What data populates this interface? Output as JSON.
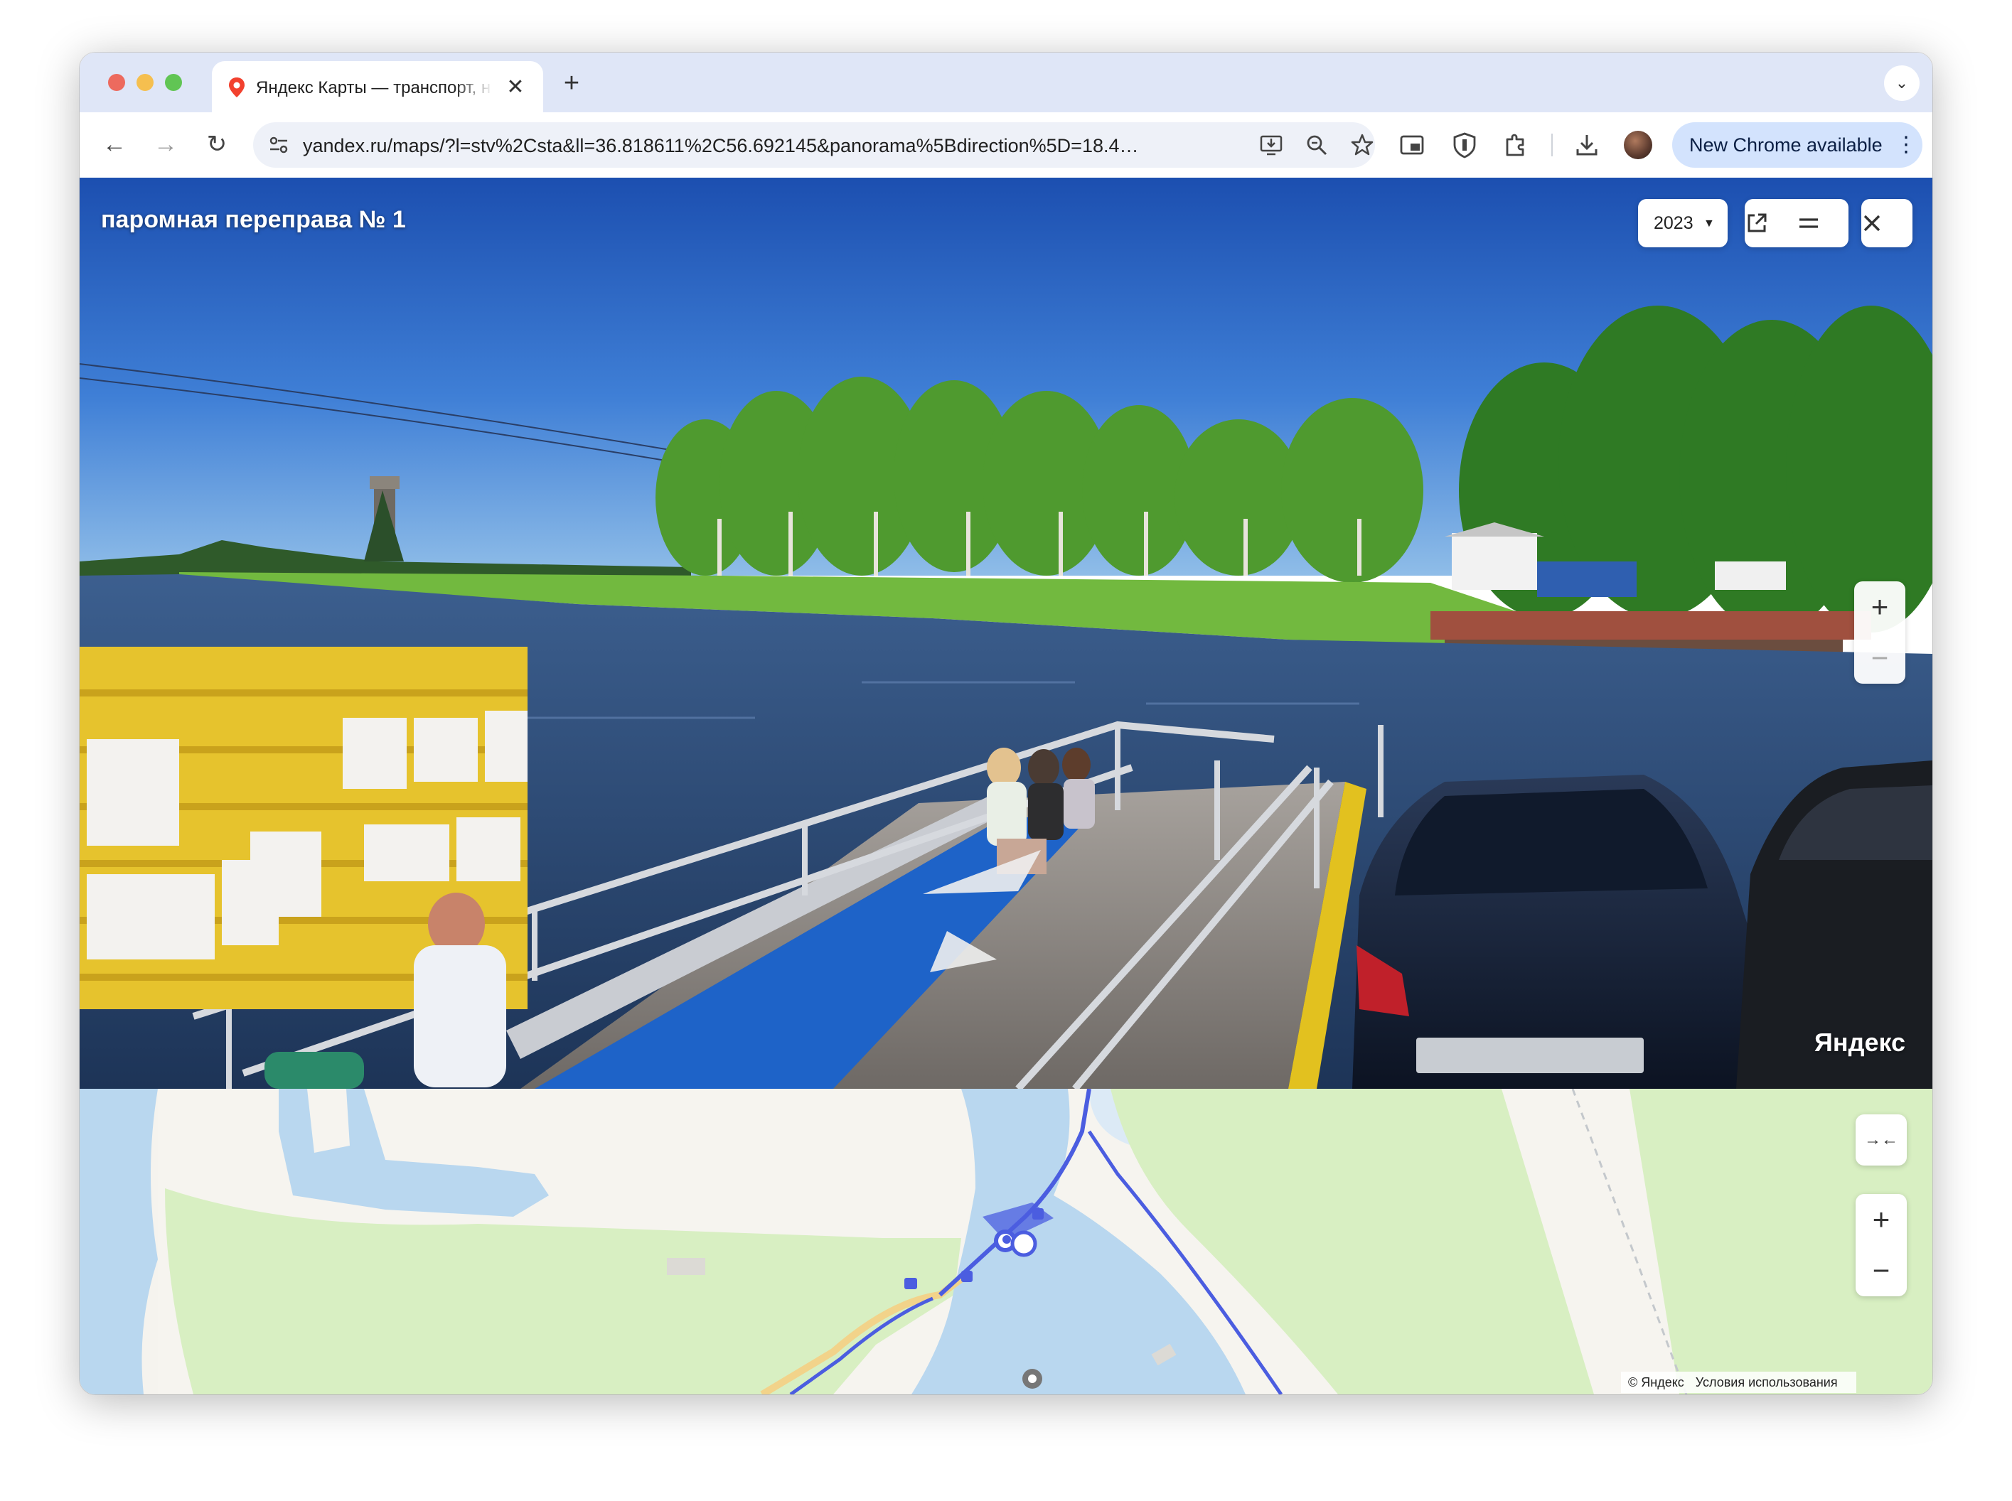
{
  "browser": {
    "tab": {
      "title": "Яндекс Карты — транспорт, навигация, поиск мест",
      "close_label": "✕"
    },
    "new_tab_label": "+",
    "tab_search_label": "⌄",
    "nav": {
      "back": "←",
      "forward": "→",
      "reload": "↻"
    },
    "url": "yandex.ru/maps/?l=stv%2Csta&ll=36.818611%2C56.692145&panorama%5Bdirection%5D=18.4…",
    "update_label": "New Chrome available",
    "update_menu": "⋮"
  },
  "panorama": {
    "title": "паромная переправа № 1",
    "year": "2023",
    "year_caret": "▼",
    "zoom_in": "+",
    "zoom_out": "−",
    "watermark": "Яндекс"
  },
  "map": {
    "collapse_label": "→←",
    "zoom_in": "+",
    "zoom_out": "−",
    "copyright": "© Яндекс",
    "terms_link": "Условия использования"
  },
  "colors": {
    "accent": "#4b5de0",
    "water": "#b9d7ef",
    "green": "#d8efc2"
  }
}
